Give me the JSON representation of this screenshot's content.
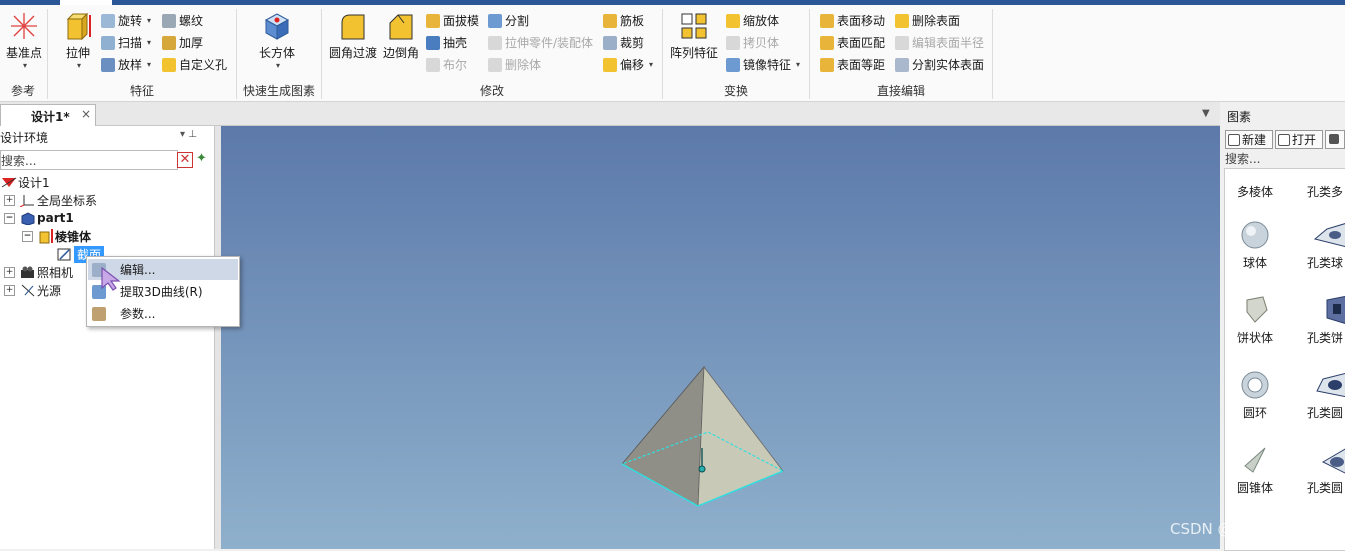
{
  "ribbon": {
    "ref": {
      "datum_label": "基准点",
      "group_label": "参考"
    },
    "feature": {
      "extrude_label": "拉伸",
      "revolve_label": "旋转",
      "sweep_label": "扫描",
      "loft_label": "放样",
      "thread_label": "螺纹",
      "thicken_label": "加厚",
      "custom_hole_label": "自定义孔",
      "group_label": "特征"
    },
    "quick": {
      "box_label": "长方体",
      "group_label": "快速生成图素"
    },
    "modify": {
      "fillet_label": "圆角过渡",
      "chamfer_label": "边倒角",
      "draft_label": "面拔模",
      "shell_label": "抽壳",
      "boolean_label": "布尔",
      "split_label": "分割",
      "extrude_part_label": "拉伸零件/装配体",
      "delete_body_label": "删除体",
      "rib_label": "筋板",
      "trim_label": "裁剪",
      "offset_label": "偏移",
      "group_label": "修改"
    },
    "transform": {
      "pattern_label": "阵列特征",
      "scale_label": "缩放体",
      "copy_label": "拷贝体",
      "mirror_label": "镜像特征",
      "group_label": "变换"
    },
    "direct": {
      "move_face_label": "表面移动",
      "match_face_label": "表面匹配",
      "offset_face_label": "表面等距",
      "delete_face_label": "删除表面",
      "edit_radius_label": "编辑表面半径",
      "split_solid_label": "分割实体表面",
      "group_label": "直接编辑"
    }
  },
  "doc_tab": {
    "title": "设计1*",
    "close": "×"
  },
  "left_panel": {
    "title": "设计环境",
    "pin": "▾  ⊥",
    "search_placeholder": "搜索...",
    "tree": {
      "design": "设计1",
      "global_cs": "全局坐标系",
      "part": "part1",
      "feature": "棱锥体",
      "section": "截面",
      "camera": "照相机",
      "light": "光源"
    }
  },
  "context_menu": {
    "edit": "编辑...",
    "extract": "提取3D曲线(R)",
    "params": "参数..."
  },
  "right_panel": {
    "title": "图素",
    "new_label": "新建",
    "open_label": "打开",
    "search_label": "搜索...",
    "shapes": [
      "多棱体",
      "孔类多",
      "球体",
      "孔类球",
      "饼状体",
      "孔类饼",
      "圆环",
      "孔类圆",
      "圆锥体",
      "孔类圆"
    ]
  },
  "watermark": "CSDN @sunflower-ly",
  "colors": {
    "accent": "#2b5797",
    "selection": "#3399ff",
    "viewport_top": "#5c79aa",
    "viewport_bottom": "#8fb0cc"
  }
}
